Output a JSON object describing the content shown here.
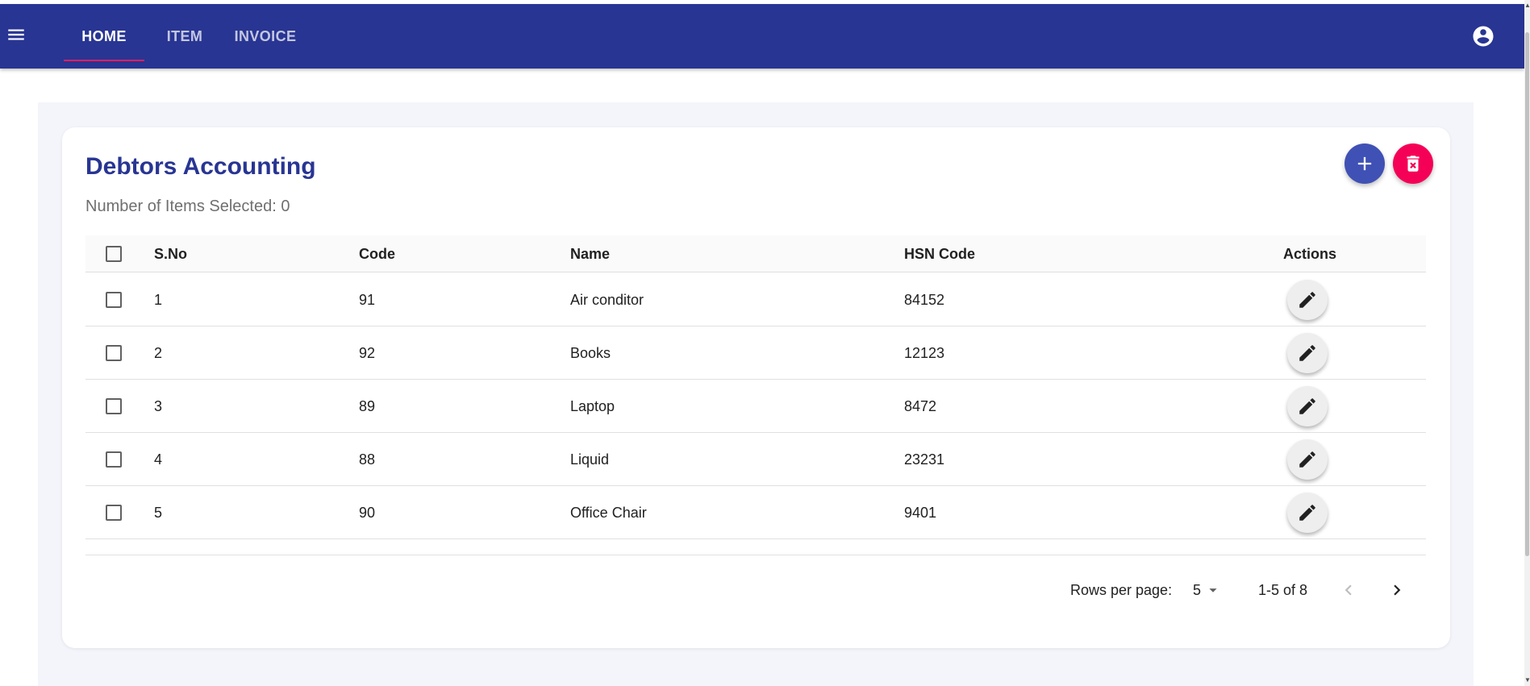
{
  "nav": {
    "tabs": [
      {
        "label": "HOME",
        "active": true
      },
      {
        "label": "ITEM",
        "active": false
      },
      {
        "label": "INVOICE",
        "active": false
      }
    ],
    "menu_icon": "hamburger-menu-icon",
    "account_icon": "account-circle-icon"
  },
  "page": {
    "title": "Debtors Accounting",
    "selected_count": "Number of Items Selected: 0",
    "add_icon": "plus-icon",
    "delete_icon": "delete-forever-icon"
  },
  "table": {
    "columns": [
      "S.No",
      "Code",
      "Name",
      "HSN Code",
      "Actions"
    ],
    "rows": [
      {
        "sno": "1",
        "code": "91",
        "name": "Air conditor",
        "hsn": "84152"
      },
      {
        "sno": "2",
        "code": "92",
        "name": "Books",
        "hsn": "12123"
      },
      {
        "sno": "3",
        "code": "89",
        "name": "Laptop",
        "hsn": "8472"
      },
      {
        "sno": "4",
        "code": "88",
        "name": "Liquid",
        "hsn": "23231"
      },
      {
        "sno": "5",
        "code": "90",
        "name": "Office Chair",
        "hsn": "9401"
      }
    ],
    "row_action_icon": "pencil-icon"
  },
  "pagination": {
    "rows_per_page_label": "Rows per page:",
    "rows_per_page_value": "5",
    "range_label": "1-5 of 8",
    "prev_enabled": false,
    "next_enabled": true
  },
  "colors": {
    "appbar": "#283593",
    "tab_indicator": "#e91e63",
    "title": "#283593",
    "fab_add": "#3f51b5",
    "fab_delete": "#f50057"
  }
}
